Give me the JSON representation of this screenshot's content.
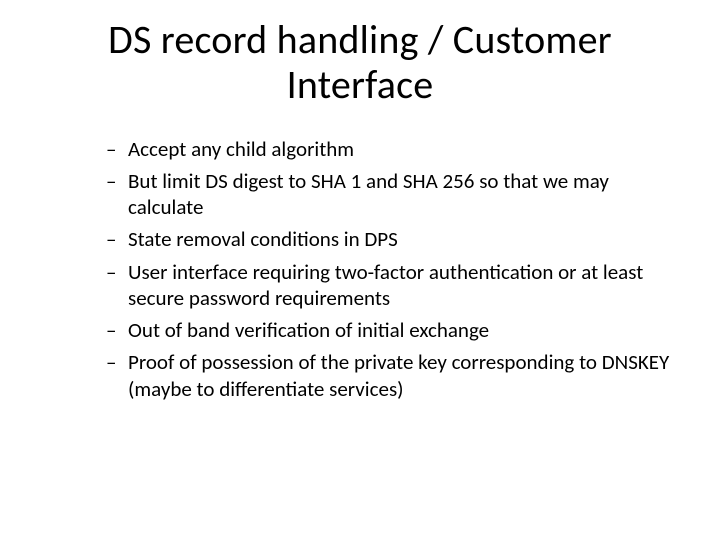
{
  "title": "DS record handling / Customer Interface",
  "bullets": [
    "Accept any child algorithm",
    "But limit DS digest to SHA 1 and SHA 256 so that we may calculate",
    "State removal conditions in DPS",
    "User interface requiring two-factor authentication or at least secure password requirements",
    "Out of band verification of initial exchange",
    "Proof of possession of the private key corresponding to DNSKEY (maybe to differentiate services)"
  ]
}
